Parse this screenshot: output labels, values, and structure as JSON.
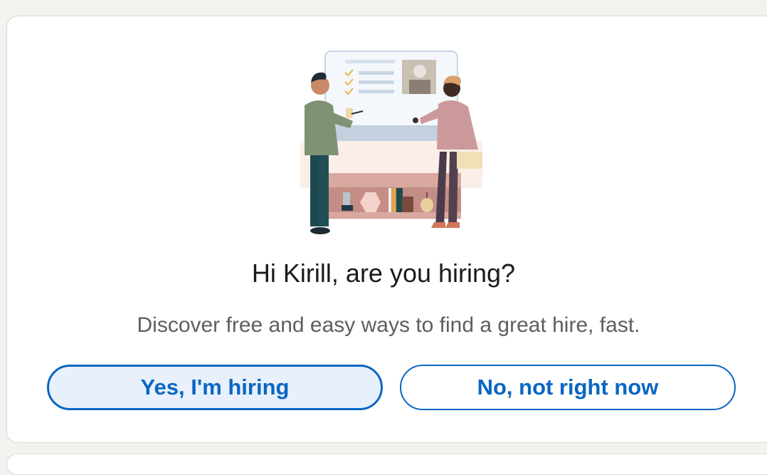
{
  "card": {
    "title": "Hi Kirill, are you hiring?",
    "subtitle": "Discover free and easy ways to find a great hire, fast.",
    "illustration_icon": "hiring-illustration"
  },
  "actions": {
    "yes_label": "Yes, I'm hiring",
    "no_label": "No, not right now"
  },
  "colors": {
    "accent": "#0a66c2",
    "yes_bg": "#e8f0fb",
    "page_bg": "#f3f2ef"
  }
}
